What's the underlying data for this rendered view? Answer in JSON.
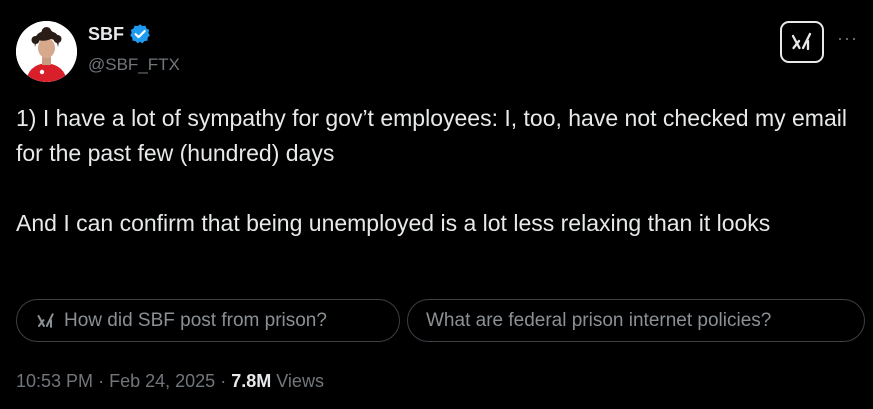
{
  "author": {
    "name": "SBF",
    "handle": "@SBF_FTX",
    "verified": true
  },
  "tweet": {
    "paragraphs": [
      "1) I have a lot of sympathy for gov’t employees: I, too, have not checked my email for the past few (hundred) days",
      "And I can confirm that being unemployed is a lot less relaxing than it looks"
    ]
  },
  "grok_suggestions": [
    "How did SBF post from prison?",
    "What are federal prison internet policies?"
  ],
  "meta": {
    "time": "10:53 PM",
    "separator": "·",
    "date": "Feb 24, 2025",
    "views_count": "7.8M",
    "views_label": "Views"
  },
  "more_label": "···",
  "icons": {
    "avatar": "avatar-photo",
    "verified": "verified-badge-icon",
    "grok": "grok-icon",
    "more": "more-icon"
  },
  "colors": {
    "background": "#000000",
    "text": "#e7e9ea",
    "secondary": "#71767b",
    "verified": "#1d9bf0",
    "chip_border": "#3a3f44",
    "avatar_shirt": "#d81f2a"
  }
}
